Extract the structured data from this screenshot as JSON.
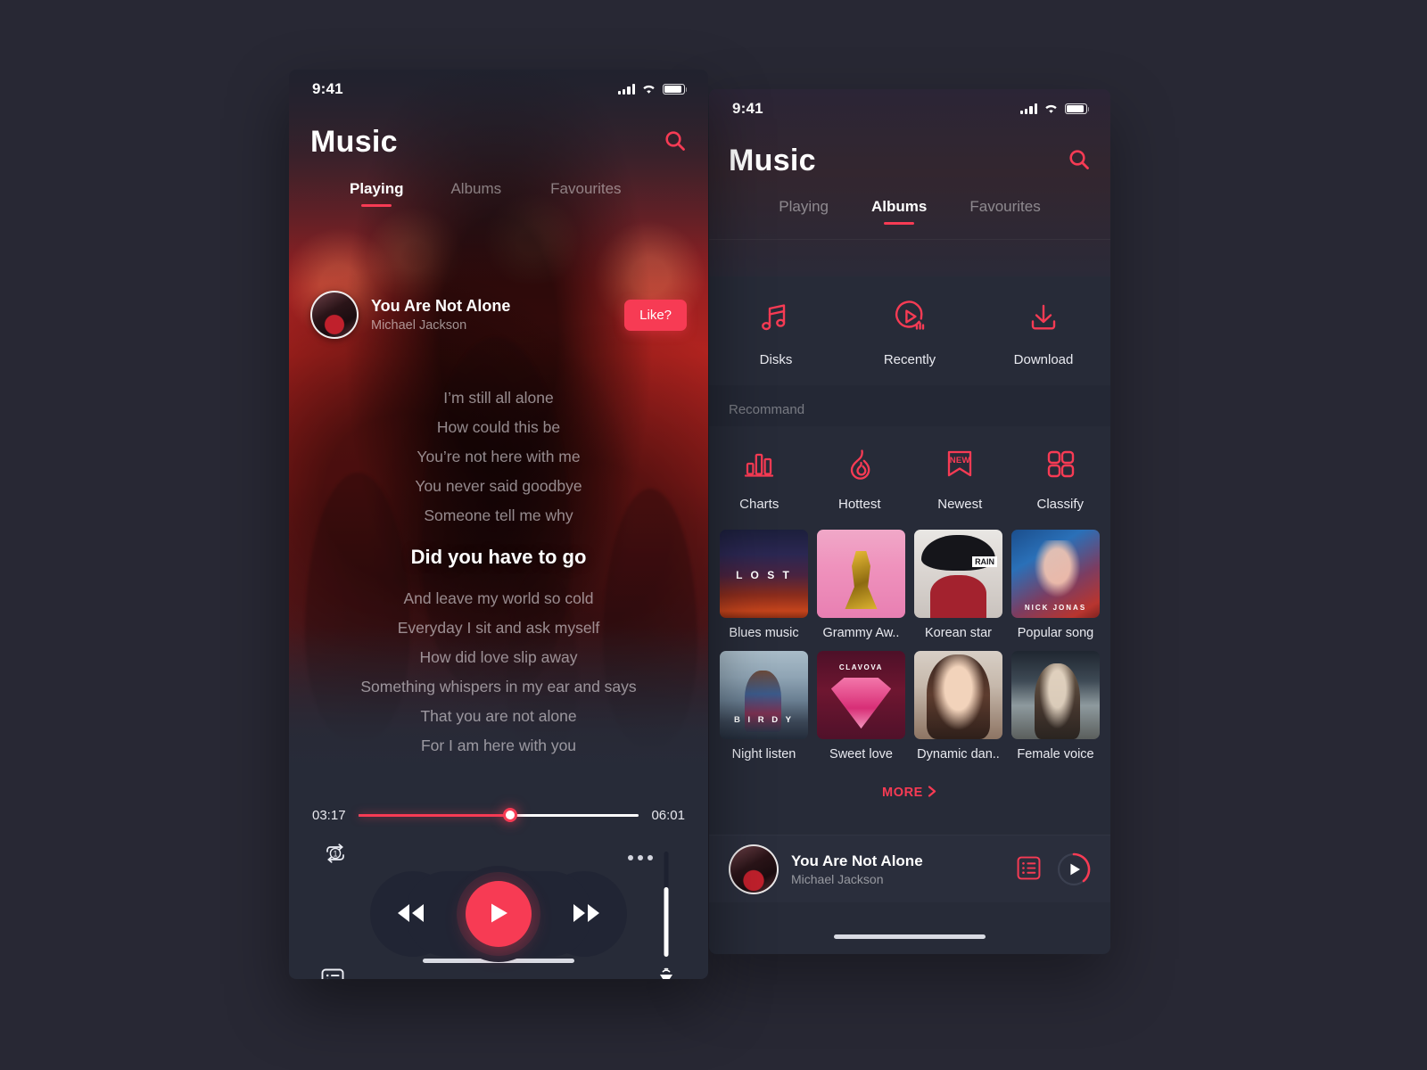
{
  "colors": {
    "accent": "#f73b54",
    "bg": "#282834",
    "panel": "#272b38",
    "panel_alt": "#2a2e3c"
  },
  "left_phone": {
    "status": {
      "time": "9:41",
      "signal_icon": "cellular-bars-icon",
      "wifi_icon": "wifi-icon",
      "battery_icon": "battery-icon"
    },
    "header": {
      "title": "Music",
      "search_icon": "search-icon"
    },
    "tabs": [
      {
        "label": "Playing",
        "active": true
      },
      {
        "label": "Albums",
        "active": false
      },
      {
        "label": "Favourites",
        "active": false
      }
    ],
    "now_playing": {
      "title": "You Are Not Alone",
      "artist": "Michael Jackson",
      "like_label": "Like?"
    },
    "lyrics": [
      {
        "text": "I’m still all alone",
        "current": false
      },
      {
        "text": "How could this be",
        "current": false
      },
      {
        "text": "You’re not here with me",
        "current": false
      },
      {
        "text": "You never said goodbye",
        "current": false
      },
      {
        "text": "Someone tell me why",
        "current": false
      },
      {
        "text": "Did you have to go",
        "current": true
      },
      {
        "text": "And leave my world so cold",
        "current": false
      },
      {
        "text": "Everyday I sit and ask myself",
        "current": false
      },
      {
        "text": "How did love slip away",
        "current": false
      },
      {
        "text": "Something whispers in my ear and says",
        "current": false
      },
      {
        "text": "That you are not alone",
        "current": false
      },
      {
        "text": "For I am here with you",
        "current": false
      }
    ],
    "player": {
      "elapsed": "03:17",
      "duration": "06:01",
      "progress_percent": 54,
      "repeat_icon": "repeat-one-icon",
      "more_icon": "more-dots-icon",
      "queue_icon": "playlist-icon",
      "prev_icon": "rewind-icon",
      "play_icon": "play-icon",
      "next_icon": "fast-forward-icon",
      "volume_icon": "volume-icon",
      "volume_percent": 66
    }
  },
  "right_phone": {
    "status": {
      "time": "9:41",
      "signal_icon": "cellular-bars-icon",
      "wifi_icon": "wifi-icon",
      "battery_icon": "battery-icon"
    },
    "header": {
      "title": "Music",
      "search_icon": "search-icon"
    },
    "tabs": [
      {
        "label": "Playing",
        "active": false
      },
      {
        "label": "Albums",
        "active": true
      },
      {
        "label": "Favourites",
        "active": false
      }
    ],
    "quick_actions": [
      {
        "label": "Disks",
        "icon": "music-note-icon"
      },
      {
        "label": "Recently",
        "icon": "recently-played-icon"
      },
      {
        "label": "Download",
        "icon": "download-icon"
      }
    ],
    "recommend": {
      "section_title": "Recommand",
      "categories": [
        {
          "label": "Charts",
          "icon": "bar-chart-icon"
        },
        {
          "label": "Hottest",
          "icon": "flame-icon"
        },
        {
          "label": "Newest",
          "icon": "new-badge-icon",
          "badge_text": "NEW"
        },
        {
          "label": "Classify",
          "icon": "grid-icon"
        }
      ],
      "albums": [
        {
          "name": "Blues music",
          "art_label": "L O S T"
        },
        {
          "name": "Grammy Aw..",
          "art_label": ""
        },
        {
          "name": "Korean star",
          "art_label": "RAIN"
        },
        {
          "name": "Popular song",
          "art_label": "NICK JONAS"
        },
        {
          "name": "Night listen",
          "art_label": "B I R D Y"
        },
        {
          "name": "Sweet love",
          "art_label": "CLAVOVA"
        },
        {
          "name": "Dynamic dan..",
          "art_label": ""
        },
        {
          "name": "Female voice",
          "art_label": ""
        }
      ],
      "more_label": "MORE",
      "more_icon": "chevron-right-icon"
    },
    "mini_player": {
      "title": "You Are Not Alone",
      "artist": "Michael Jackson",
      "queue_icon": "playlist-icon",
      "play_icon": "play-circle-icon",
      "progress_percent": 30
    }
  }
}
